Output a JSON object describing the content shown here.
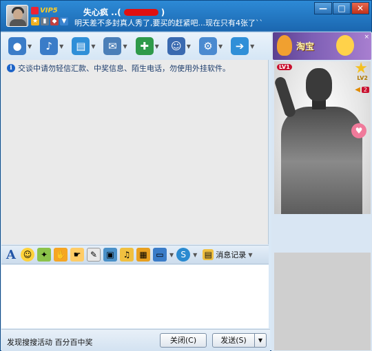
{
  "header": {
    "vip_label": "VIP5",
    "contact_name": "失心疯 ..(",
    "contact_name_suffix": ")",
    "signature": "明天差不多封真人秀了,要买的赶紧吧...现在只有4张了``"
  },
  "window_buttons": {
    "minimize": "—",
    "maximize": "□",
    "close": "✕"
  },
  "toolbar": {
    "items": [
      {
        "name": "video",
        "icon": "webcam-icon",
        "color": "#3a7cc8",
        "glyph": "●"
      },
      {
        "name": "voice",
        "icon": "microphone-icon",
        "color": "#3a7cc8",
        "glyph": "♪"
      },
      {
        "name": "file",
        "icon": "folder-transfer-icon",
        "color": "#2f8fd8",
        "glyph": "▤"
      },
      {
        "name": "email",
        "icon": "mail-icon",
        "color": "#4b7fb8",
        "glyph": "✉"
      },
      {
        "name": "sms",
        "icon": "message-add-icon",
        "color": "#2e9a4a",
        "glyph": "✚"
      },
      {
        "name": "group",
        "icon": "user-group-icon",
        "color": "#3a6ab0",
        "glyph": "☺"
      },
      {
        "name": "apps",
        "icon": "apps-settings-icon",
        "color": "#4a8ad0",
        "glyph": "⚙"
      },
      {
        "name": "more",
        "icon": "globe-arrow-icon",
        "color": "#2f8fd8",
        "glyph": "➔"
      }
    ]
  },
  "warning": {
    "text": "交谈中请勿轻信汇款、中奖信息、陌生电话，勿使用外挂软件。"
  },
  "format_bar": {
    "font_glyph": "A",
    "message_record_label": "消息记录"
  },
  "right_panel": {
    "banner_text": "淘宝",
    "level_tag": "LV1",
    "level2_tag": "LV2",
    "volume": "2"
  },
  "bottom": {
    "promo": "发现搜搜活动 百分百中奖",
    "close_label": "关闭(C)",
    "send_label": "发送(S)",
    "send_arrow": "▼"
  }
}
